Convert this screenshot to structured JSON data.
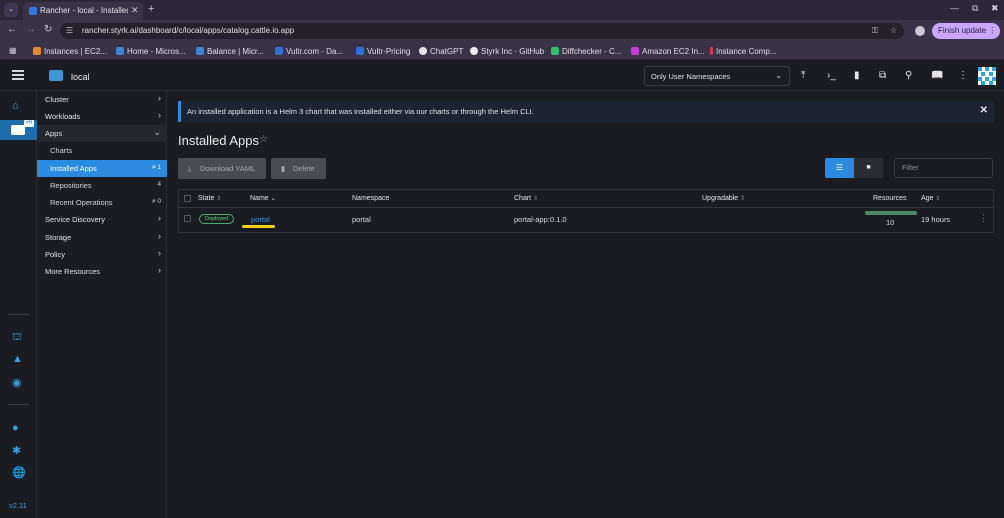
{
  "browser": {
    "tab_title": "Rancher - local - Installed",
    "url": "rancher.styrk.ai/dashboard/c/local/apps/catalog.cattle.io.app",
    "finish_update": "Finish update",
    "bookmarks": [
      "Instances | EC2...",
      "Home - Micros...",
      "Balance | Micr...",
      "Vultr.com - Da...",
      "Vultr-Pricing",
      "ChatGPT",
      "Styrk Inc · GitHub",
      "Diffchecker - C...",
      "Amazon EC2 In...",
      "Instance Comp..."
    ]
  },
  "header": {
    "cluster_name": "local",
    "namespace_filter": "Only User Namespaces"
  },
  "rail": {
    "badge": "≠H",
    "version": "v2.11"
  },
  "sidenav": {
    "groups": [
      "Cluster",
      "Workloads",
      "Apps",
      "Service Discovery",
      "Storage",
      "Policy",
      "More Resources"
    ],
    "apps_children": [
      {
        "label": "Charts",
        "count": ""
      },
      {
        "label": "Installed Apps",
        "count": "≠ 1"
      },
      {
        "label": "Repositories",
        "count": "4"
      },
      {
        "label": "Recent Operations",
        "count": "≠ 0"
      }
    ]
  },
  "main": {
    "banner": "An installed application is a Helm 3 chart that was installed either via our charts or through the Helm CLI.",
    "title": "Installed Apps",
    "download_yaml": "Download YAML",
    "delete": "Delete",
    "filter_placeholder": "Filter",
    "columns": [
      "State",
      "Name",
      "Namespace",
      "Chart",
      "Upgradable",
      "Resources",
      "Age"
    ],
    "rows": [
      {
        "state": "Deployed",
        "name": "portal",
        "namespace": "portal",
        "chart": "portal-app:0.1.0",
        "upgradable": "",
        "resources": "10",
        "age": "19 hours"
      }
    ]
  },
  "colors": {
    "accent": "#2a8be0",
    "deployed": "#5fcf82",
    "highlight": "#f1d10f"
  }
}
